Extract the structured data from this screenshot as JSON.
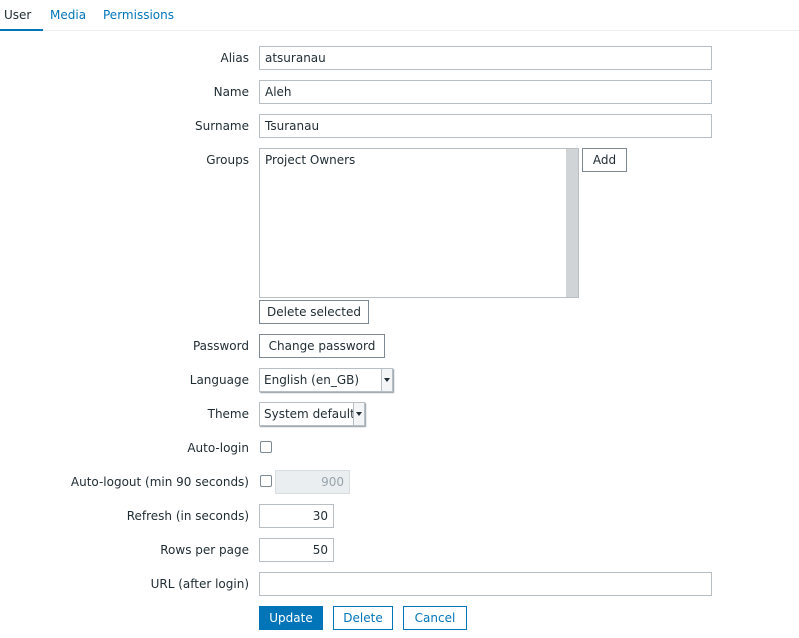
{
  "tabs": [
    {
      "label": "User"
    },
    {
      "label": "Media"
    },
    {
      "label": "Permissions"
    }
  ],
  "form": {
    "alias": {
      "label": "Alias",
      "value": "atsuranau"
    },
    "name": {
      "label": "Name",
      "value": "Aleh"
    },
    "surname": {
      "label": "Surname",
      "value": "Tsuranau"
    },
    "groups": {
      "label": "Groups",
      "items": [
        "Project Owners"
      ],
      "add_label": "Add",
      "delete_label": "Delete selected"
    },
    "password": {
      "label": "Password",
      "button_label": "Change password"
    },
    "language": {
      "label": "Language",
      "value": "English (en_GB)"
    },
    "theme": {
      "label": "Theme",
      "value": "System default"
    },
    "autologin": {
      "label": "Auto-login",
      "checked": false
    },
    "autologout": {
      "label": "Auto-logout (min 90 seconds)",
      "checked": false,
      "value": "900"
    },
    "refresh": {
      "label": "Refresh (in seconds)",
      "value": "30"
    },
    "rows_per_page": {
      "label": "Rows per page",
      "value": "50"
    },
    "url": {
      "label": "URL (after login)",
      "value": ""
    }
  },
  "actions": {
    "update_label": "Update",
    "delete_label": "Delete",
    "cancel_label": "Cancel"
  },
  "colors": {
    "accent": "#0275b8",
    "border": "#b7bfc5",
    "text": "#1f2c33"
  }
}
